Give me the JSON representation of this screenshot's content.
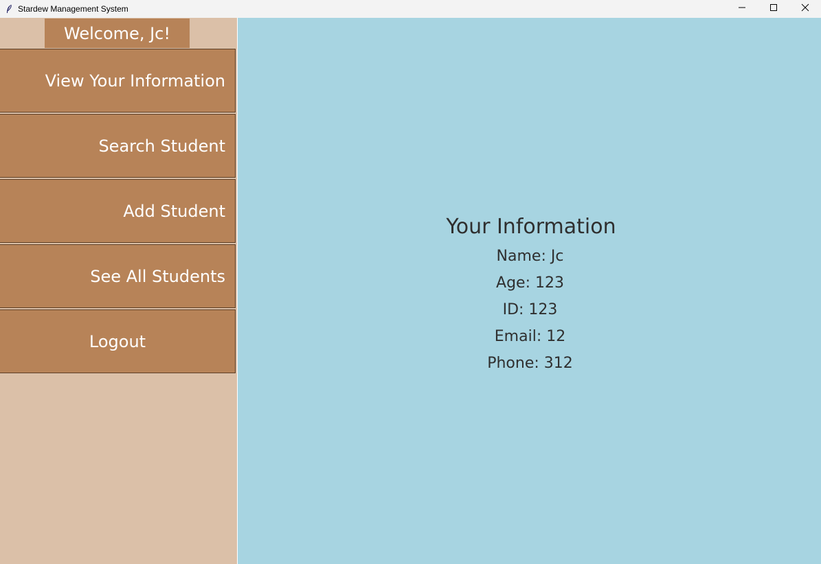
{
  "window": {
    "title": "Stardew Management System",
    "icon": "feather-icon",
    "controls": [
      "minimize-icon",
      "maximize-icon",
      "close-icon"
    ]
  },
  "sidebar": {
    "welcome": "Welcome, Jc!",
    "items": [
      {
        "label": "View Your Information"
      },
      {
        "label": "Search Student"
      },
      {
        "label": "Add Student"
      },
      {
        "label": "See All Students"
      },
      {
        "label": "Logout"
      }
    ]
  },
  "main": {
    "title": "Your Information",
    "fields": {
      "name": "Name: Jc",
      "age": "Age: 123",
      "id": "ID: 123",
      "email": "Email: 12",
      "phone": "Phone: 312"
    }
  },
  "colors": {
    "sidebar_bg": "#dbc0a8",
    "button_bg": "#b78358",
    "main_bg": "#a7d4e1",
    "text_light": "#ffffff",
    "text_dark": "#2f2f2f"
  }
}
